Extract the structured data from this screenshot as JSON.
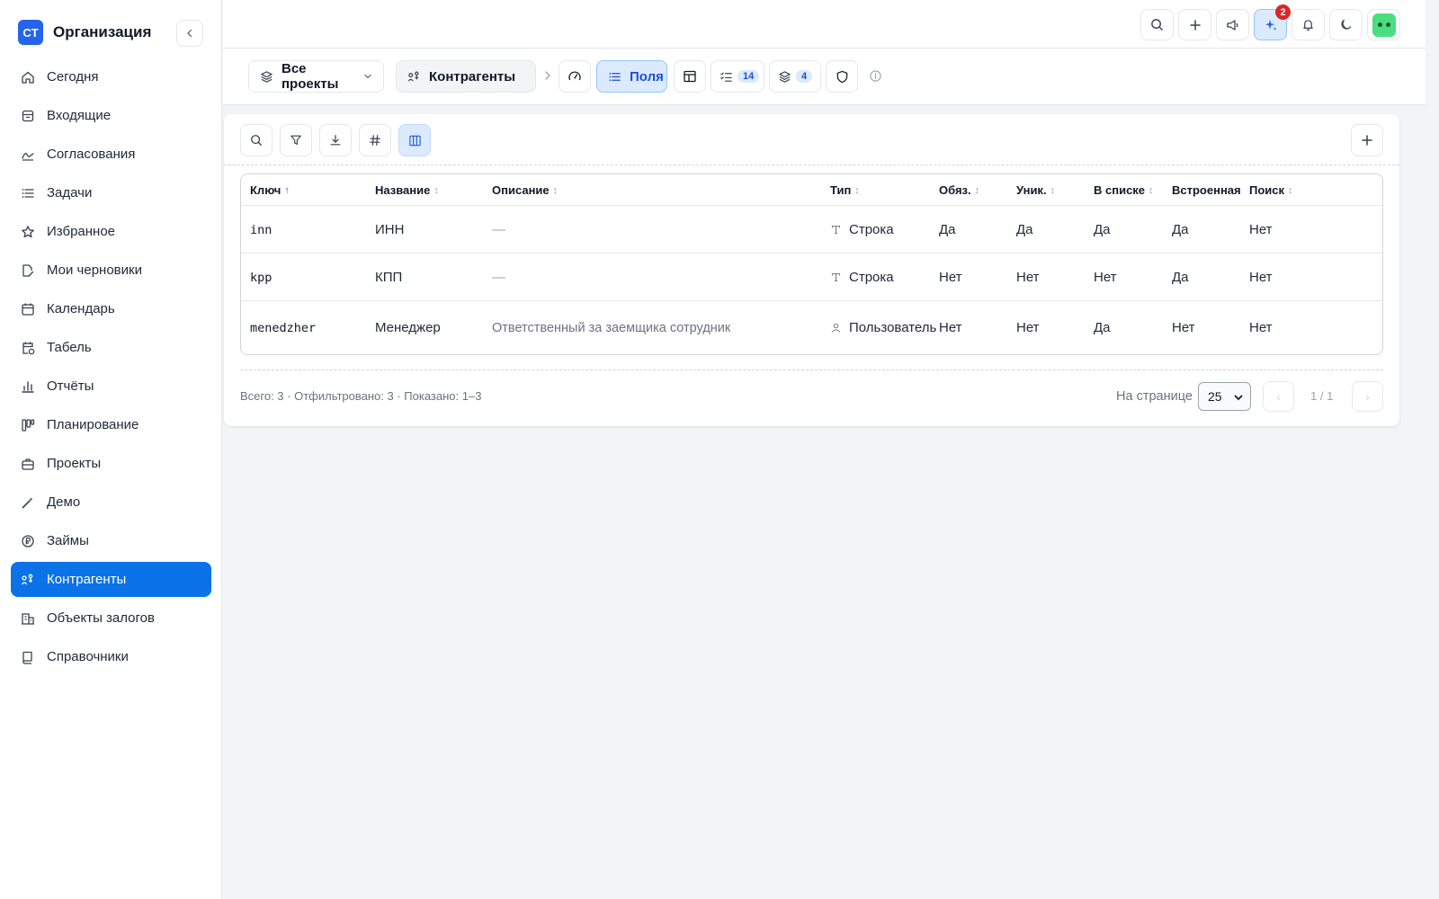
{
  "org": {
    "logo": "CT",
    "name": "Организация"
  },
  "sidebar": {
    "items": [
      {
        "label": "Сегодня",
        "icon": "home-icon"
      },
      {
        "label": "Входящие",
        "icon": "inbox-icon"
      },
      {
        "label": "Согласования",
        "icon": "signature-icon"
      },
      {
        "label": "Задачи",
        "icon": "list-icon"
      },
      {
        "label": "Избранное",
        "icon": "star-icon"
      },
      {
        "label": "Мои черновики",
        "icon": "draft-icon"
      },
      {
        "label": "Календарь",
        "icon": "calendar-icon"
      },
      {
        "label": "Табель",
        "icon": "calendar-clock-icon"
      },
      {
        "label": "Отчёты",
        "icon": "chart-icon"
      },
      {
        "label": "Планирование",
        "icon": "kanban-icon"
      },
      {
        "label": "Проекты",
        "icon": "briefcase-icon"
      },
      {
        "label": "Демо",
        "icon": "wand-icon"
      },
      {
        "label": "Займы",
        "icon": "ruble-icon"
      },
      {
        "label": "Контрагенты",
        "icon": "contractors-icon",
        "active": true
      },
      {
        "label": "Объекты залогов",
        "icon": "building-icon"
      },
      {
        "label": "Справочники",
        "icon": "book-icon"
      }
    ]
  },
  "topbar": {
    "ai_badge": "2"
  },
  "subbar": {
    "projects_label": "Все проекты",
    "entity_label": "Контрагенты",
    "fields_label": "Поля",
    "checklist_count": "14",
    "layers_count": "4"
  },
  "table": {
    "columns": [
      {
        "key": "key",
        "label": "Ключ"
      },
      {
        "key": "name",
        "label": "Название"
      },
      {
        "key": "description",
        "label": "Описание"
      },
      {
        "key": "type",
        "label": "Тип"
      },
      {
        "key": "required",
        "label": "Обяз."
      },
      {
        "key": "unique",
        "label": "Уник."
      },
      {
        "key": "in_list",
        "label": "В списке"
      },
      {
        "key": "builtin",
        "label": "Встроенная"
      },
      {
        "key": "search",
        "label": "Поиск"
      }
    ],
    "rows": [
      {
        "key": "inn",
        "name": "ИНН",
        "description": "—",
        "type": "Строка",
        "type_icon": "text-type-icon",
        "required": "Да",
        "unique": "Да",
        "in_list": "Да",
        "builtin": "Да",
        "search": "Нет"
      },
      {
        "key": "kpp",
        "name": "КПП",
        "description": "—",
        "type": "Строка",
        "type_icon": "text-type-icon",
        "required": "Нет",
        "unique": "Нет",
        "in_list": "Нет",
        "builtin": "Да",
        "search": "Нет"
      },
      {
        "key": "menedzher",
        "name": "Менеджер",
        "description": "Ответственный за заемщика сотрудник",
        "type": "Пользователь",
        "type_icon": "user-type-icon",
        "required": "Нет",
        "unique": "Нет",
        "in_list": "Да",
        "builtin": "Нет",
        "search": "Нет"
      }
    ]
  },
  "footer": {
    "summary": "Всего: 3 · Отфильтровано: 3 · Показано: 1–3",
    "per_page_label": "На странице",
    "per_page_value": "25",
    "page_indicator": "1 / 1",
    "prev": "‹",
    "next": "›"
  }
}
